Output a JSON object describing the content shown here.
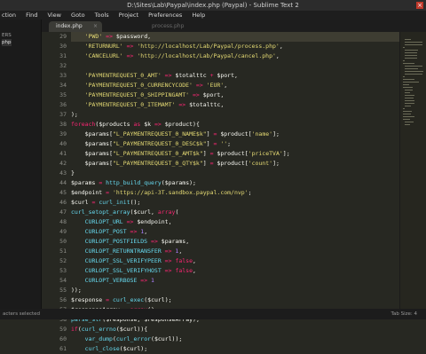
{
  "window": {
    "title": "D:\\Sites\\Lab\\Paypal\\index.php (Paypal) - Sublime Text 2"
  },
  "menu": [
    "ction",
    "Find",
    "View",
    "Goto",
    "Tools",
    "Project",
    "Preferences",
    "Help"
  ],
  "sidebar": {
    "folders": [
      "ERS",
      "php"
    ]
  },
  "tabs": [
    {
      "label": "index.php",
      "active": true
    },
    {
      "label": "process.php",
      "active": false
    }
  ],
  "status": {
    "left": "acters selected",
    "right": "Tab Size: 4"
  },
  "code_lines": [
    {
      "num": "29",
      "text": "    'PWD' => $password,"
    },
    {
      "num": "30",
      "text": "    'RETURNURL' => 'http://localhost/Lab/Paypal/process.php',"
    },
    {
      "num": "31",
      "text": "    'CANCELURL' => 'http://localhost/Lab/Paypal/cancel.php',"
    },
    {
      "num": "32",
      "text": ""
    },
    {
      "num": "33",
      "text": "    'PAYMENTREQUEST_0_AMT' => $totalttc + $port,"
    },
    {
      "num": "34",
      "text": "    'PAYMENTREQUEST_0_CURRENCYCODE' => 'EUR',"
    },
    {
      "num": "35",
      "text": "    'PAYMENTREQUEST_0_SHIPPINGAMT' => $port,"
    },
    {
      "num": "36",
      "text": "    'PAYMENTREQUEST_0_ITEMAMT' => $totalttc,"
    },
    {
      "num": "37",
      "text": ");"
    },
    {
      "num": "38",
      "text": "foreach($products as $k => $product){"
    },
    {
      "num": "39",
      "text": "    $params[\"L_PAYMENTREQUEST_0_NAME$k\"] = $product['name'];"
    },
    {
      "num": "40",
      "text": "    $params[\"L_PAYMENTREQUEST_0_DESC$k\"] = '';"
    },
    {
      "num": "41",
      "text": "    $params[\"L_PAYMENTREQUEST_0_AMT$k\"] = $product['priceTVA'];"
    },
    {
      "num": "42",
      "text": "    $params[\"L_PAYMENTREQUEST_0_QTY$k\"] = $product['count'];"
    },
    {
      "num": "43",
      "text": "}"
    },
    {
      "num": "44",
      "text": "$params = http_build_query($params);"
    },
    {
      "num": "45",
      "text": "$endpoint = 'https://api-3T.sandbox.paypal.com/nvp';"
    },
    {
      "num": "46",
      "text": "$curl = curl_init();"
    },
    {
      "num": "47",
      "text": "curl_setopt_array($curl, array("
    },
    {
      "num": "48",
      "text": "    CURLOPT_URL => $endpoint,"
    },
    {
      "num": "49",
      "text": "    CURLOPT_POST => 1,"
    },
    {
      "num": "50",
      "text": "    CURLOPT_POSTFIELDS => $params,"
    },
    {
      "num": "51",
      "text": "    CURLOPT_RETURNTRANSFER => 1,"
    },
    {
      "num": "52",
      "text": "    CURLOPT_SSL_VERIFYPEER => false,"
    },
    {
      "num": "53",
      "text": "    CURLOPT_SSL_VERIFYHOST => false,"
    },
    {
      "num": "54",
      "text": "    CURLOPT_VERBOSE => 1"
    },
    {
      "num": "55",
      "text": "));"
    },
    {
      "num": "56",
      "text": "$response = curl_exec($curl);"
    },
    {
      "num": "57",
      "text": "$responseArray = array();"
    },
    {
      "num": "58",
      "text": "parse_str($response, $responseArray);"
    },
    {
      "num": "59",
      "text": "if(curl_errno($curl)){"
    },
    {
      "num": "60",
      "text": "    var_dump(curl_error($curl));"
    },
    {
      "num": "61",
      "text": "    curl_close($curl);"
    }
  ],
  "colors": {
    "background": "#272822",
    "keyword": "#f92672",
    "string": "#e6db74",
    "function": "#66d9ef",
    "number": "#ae81ff"
  }
}
